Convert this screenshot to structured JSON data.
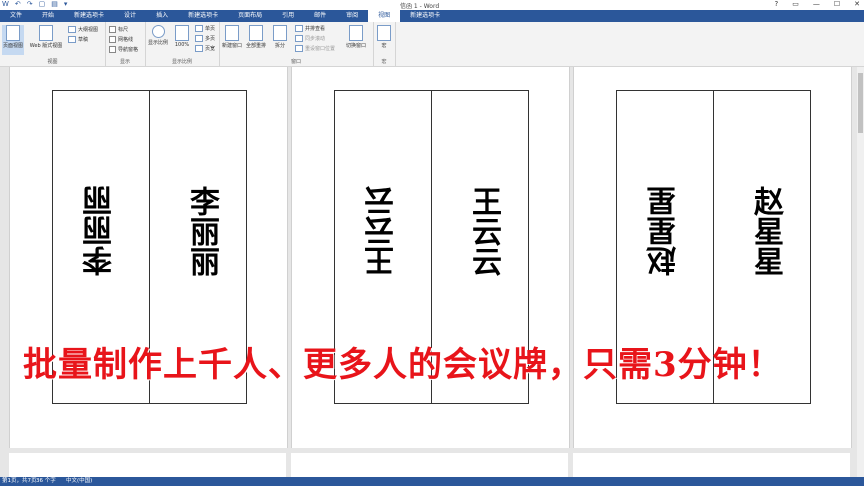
{
  "window": {
    "title": "信函 1 - Word",
    "controls": [
      "?",
      "▭",
      "—",
      "☐",
      "✕"
    ]
  },
  "quick_access": [
    "W",
    "↶",
    "↷",
    "▢",
    "▤",
    "▾"
  ],
  "tabs": [
    {
      "label": "文件"
    },
    {
      "label": "开始"
    },
    {
      "label": "新建选项卡"
    },
    {
      "label": "设计"
    },
    {
      "label": "插入"
    },
    {
      "label": "新建选项卡"
    },
    {
      "label": "页面布局"
    },
    {
      "label": "引用"
    },
    {
      "label": "邮件"
    },
    {
      "label": "审阅"
    },
    {
      "label": "视图"
    },
    {
      "label": "新建选项卡"
    }
  ],
  "ribbon": {
    "views": {
      "label": "视图",
      "page_view": "页面视图",
      "web_view": "Web 版式视图",
      "outline": "大纲视图",
      "draft": "草稿"
    },
    "show": {
      "label": "显示",
      "ruler": "标尺",
      "gridlines": "网格线",
      "nav_pane": "导航窗格"
    },
    "zoom": {
      "label": "显示比例",
      "zoom": "显示比例",
      "hundred": "100%",
      "one_page": "单页",
      "multi_page": "多页",
      "page_width": "页宽"
    },
    "window": {
      "label": "窗口",
      "new_window": "新建窗口",
      "arrange_all": "全部重排",
      "split": "拆分",
      "side_by_side": "并排查看",
      "sync_scroll": "同步滚动",
      "reset_pos": "重设窗口位置",
      "switch": "切换窗口"
    },
    "macros": {
      "label": "宏",
      "macros": "宏"
    }
  },
  "pages": [
    {
      "left_name": "李丽丽",
      "right_name": "李丽丽"
    },
    {
      "left_name": "王云云",
      "right_name": "王云云"
    },
    {
      "left_name": "赵星星",
      "right_name": "赵星星"
    }
  ],
  "banner": "批量制作上千人、更多人的会议牌，只需3分钟！",
  "status": {
    "page": "第1页，共7页",
    "words": "36 个字",
    "lang": "中文(中国)"
  },
  "accent_color": "#2b579a",
  "banner_color": "#e8141a"
}
